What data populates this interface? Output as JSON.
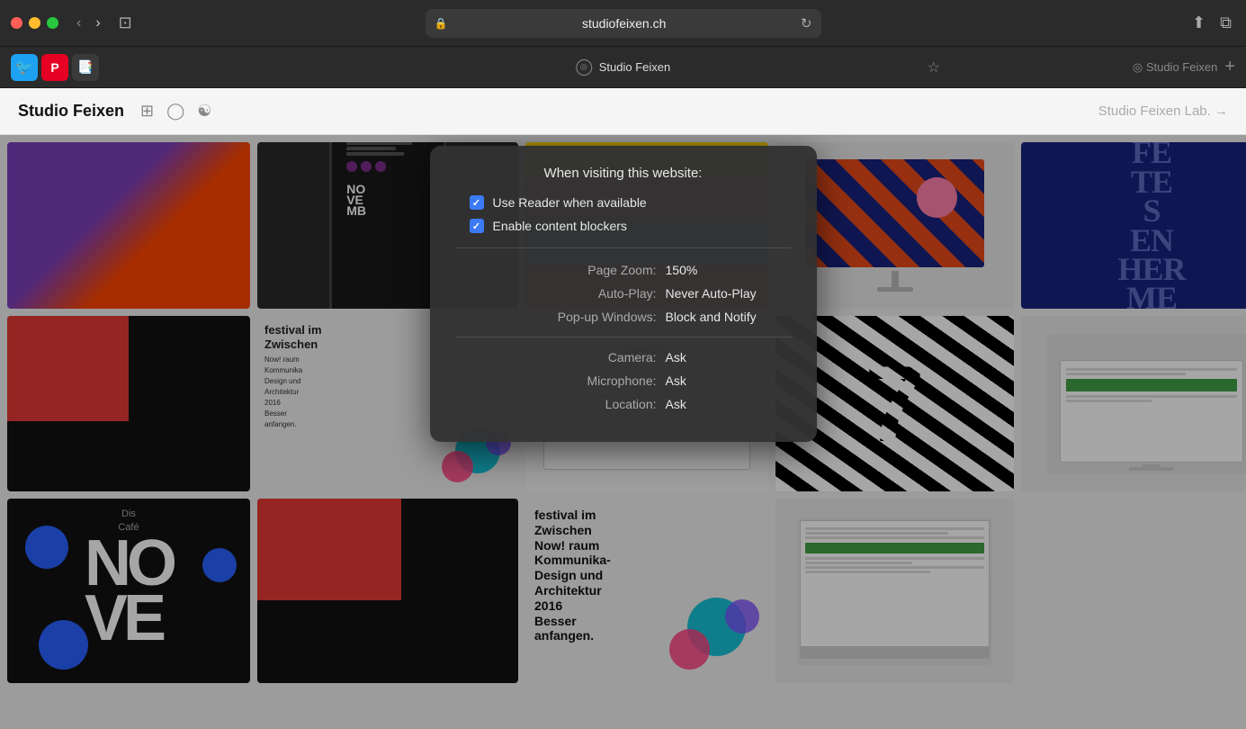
{
  "titlebar": {
    "address": "studiofeixen.ch",
    "back_label": "‹",
    "forward_label": "›",
    "reload_label": "↻",
    "share_label": "⬆",
    "tabs_label": "⧉"
  },
  "tabbar": {
    "tab_title": "Studio Feixen",
    "add_tab_label": "+",
    "star_label": "☆"
  },
  "page_header": {
    "site_title": "Studio Feixen",
    "lab_link": "Studio Feixen Lab. →"
  },
  "popup": {
    "title": "When visiting this website:",
    "use_reader_label": "Use Reader when available",
    "content_blockers_label": "Enable content blockers",
    "page_zoom_label": "Page Zoom:",
    "page_zoom_value": "150%",
    "auto_play_label": "Auto-Play:",
    "auto_play_value": "Never Auto-Play",
    "popup_windows_label": "Pop-up Windows:",
    "popup_windows_value": "Block and Notify",
    "camera_label": "Camera:",
    "camera_value": "Ask",
    "microphone_label": "Microphone:",
    "microphone_value": "Ask",
    "location_label": "Location:",
    "location_value": "Ask"
  },
  "icons": {
    "lock": "🔒",
    "twitter": "🐦",
    "pinterest": "P",
    "bookmark": "📑",
    "checkmark": "✓",
    "share": "⬆",
    "tab_grid": "⊞"
  }
}
